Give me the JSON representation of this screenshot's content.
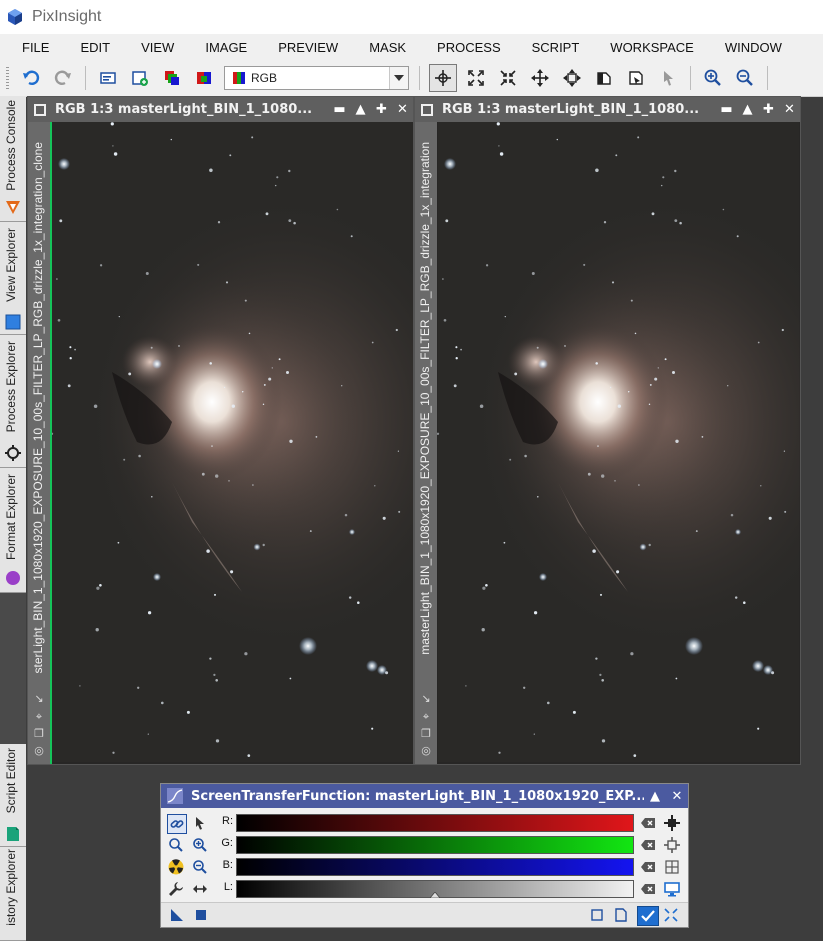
{
  "app": {
    "title": "PixInsight"
  },
  "menu": [
    "FILE",
    "EDIT",
    "VIEW",
    "IMAGE",
    "PREVIEW",
    "MASK",
    "PROCESS",
    "SCRIPT",
    "WORKSPACE",
    "WINDOW"
  ],
  "toolbar": {
    "color_space_value": "RGB"
  },
  "dock_tabs": {
    "process_console": "Process Console",
    "view_explorer": "View Explorer",
    "process_explorer": "Process Explorer",
    "format_explorer": "Format Explorer",
    "script_editor": "Script Editor",
    "history_explorer": "istory Explorer"
  },
  "window_left": {
    "title": "RGB 1:3 masterLight_BIN_1_1080...",
    "view_id": "sterLight_BIN_1_1080x1920_EXPOSURE_10_00s_FILTER_LP_RGB_drizzle_1x_integration_clone"
  },
  "window_right": {
    "title": "RGB 1:3 masterLight_BIN_1_1080...",
    "view_id": "masterLight_BIN_1_1080x1920_EXPOSURE_10_00s_FILTER_LP_RGB_drizzle_1x_integration"
  },
  "stf": {
    "title": "ScreenTransferFunction: masterLight_BIN_1_1080x1920_EXP...",
    "channels": [
      {
        "label": "R:",
        "color": "#e0161a"
      },
      {
        "label": "G:",
        "color": "#12e612"
      },
      {
        "label": "B:",
        "color": "#1414f0"
      },
      {
        "label": "L:",
        "color": "#f2f2f2"
      }
    ],
    "midtones_marker": 0.5
  },
  "colors": {
    "workspace_bg": "#3d3d3d",
    "window_title": "#5f5f5f",
    "stf_title": "#4b5aa0",
    "accent_blue": "#1f6ecf"
  }
}
